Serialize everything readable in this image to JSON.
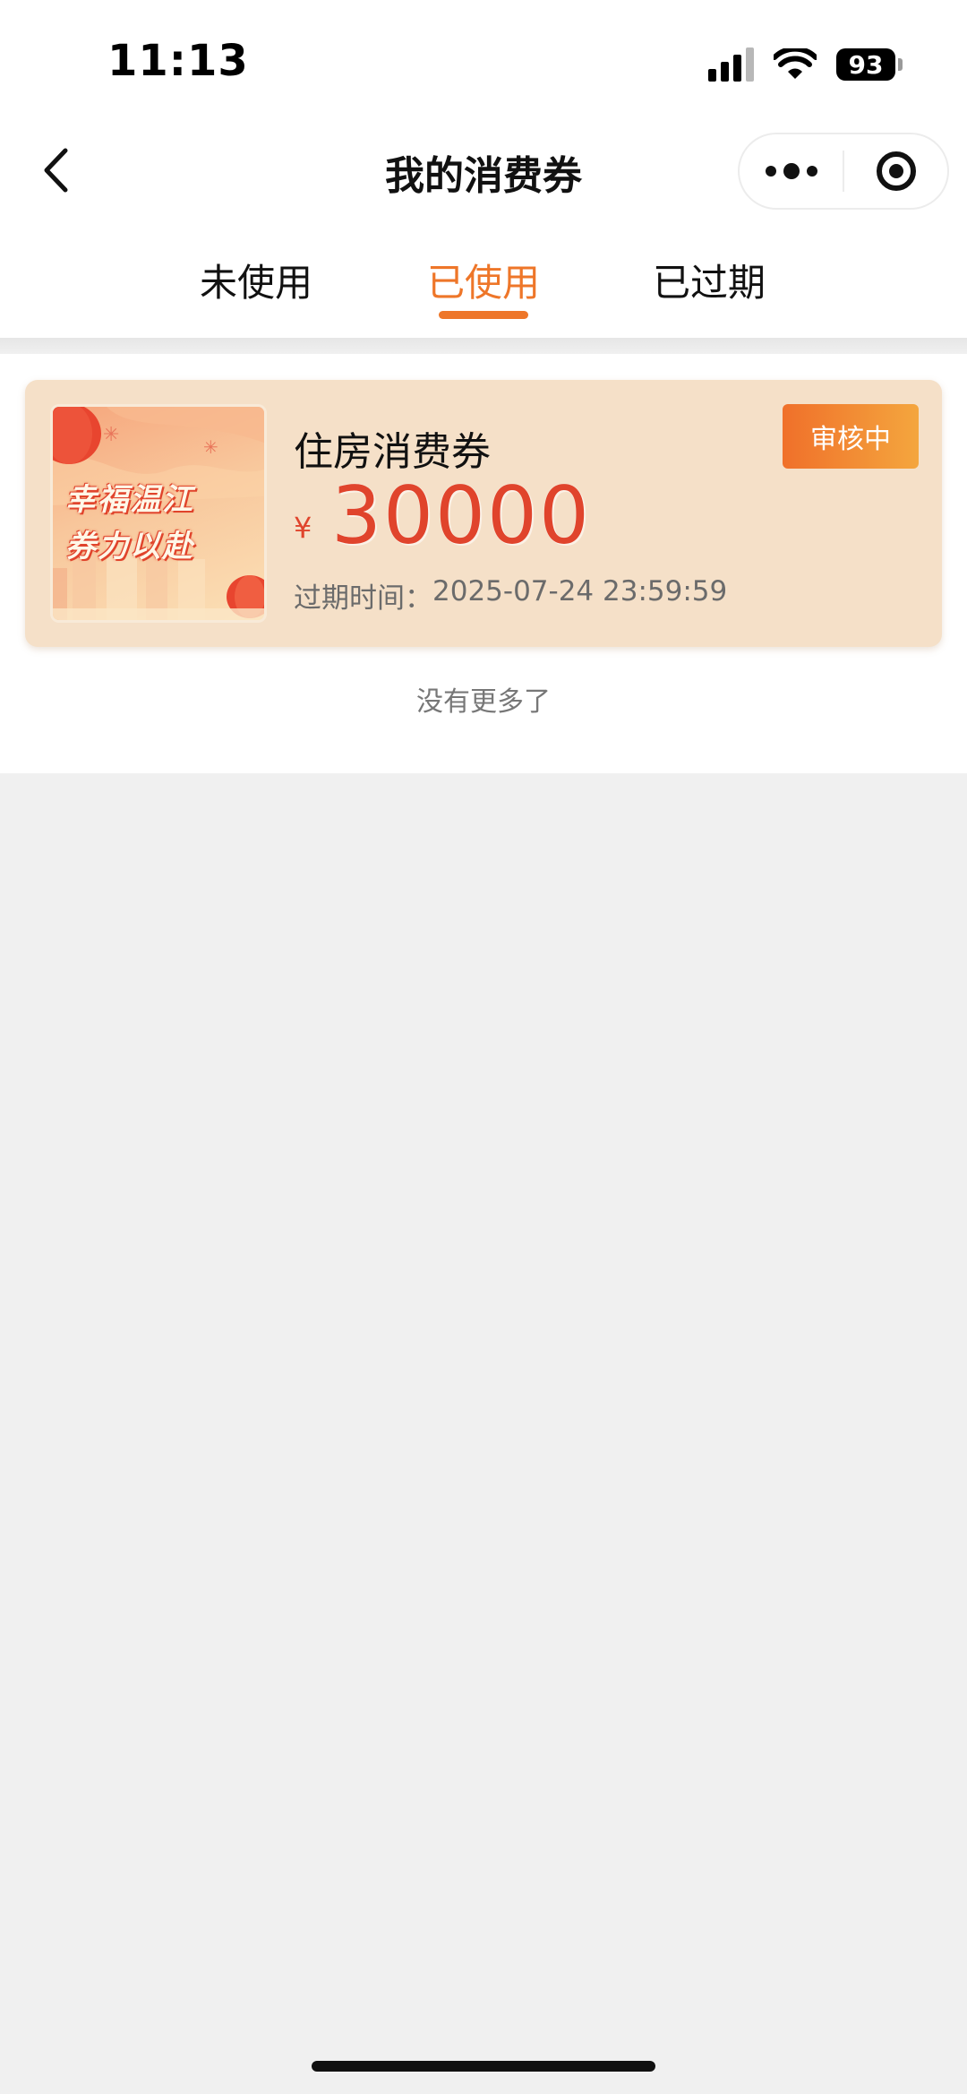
{
  "status_bar": {
    "time": "11:13",
    "battery": "93",
    "icons": [
      "signal-icon",
      "wifi-icon",
      "battery-icon"
    ]
  },
  "nav": {
    "title": "我的消费券",
    "back_icon": "chevron-left-icon",
    "more_icon": "more-dots-icon",
    "close_icon": "target-icon"
  },
  "tabs": [
    {
      "label": "未使用",
      "active": false
    },
    {
      "label": "已使用",
      "active": true
    },
    {
      "label": "已过期",
      "active": false
    }
  ],
  "coupon": {
    "image_slogan_line1": "幸福温江",
    "image_slogan_line2": "券力以赴",
    "title": "住房消费券",
    "status": "审核中",
    "currency": "¥",
    "amount": "30000",
    "expiry_label": "过期时间：",
    "expiry_value": "2025-07-24 23:59:59"
  },
  "list_end_text": "没有更多了",
  "colors": {
    "accent": "#ee7629",
    "card_bg": "#f5e0c8",
    "amount": "#e0442c",
    "page_bg": "#f0f0f0"
  }
}
